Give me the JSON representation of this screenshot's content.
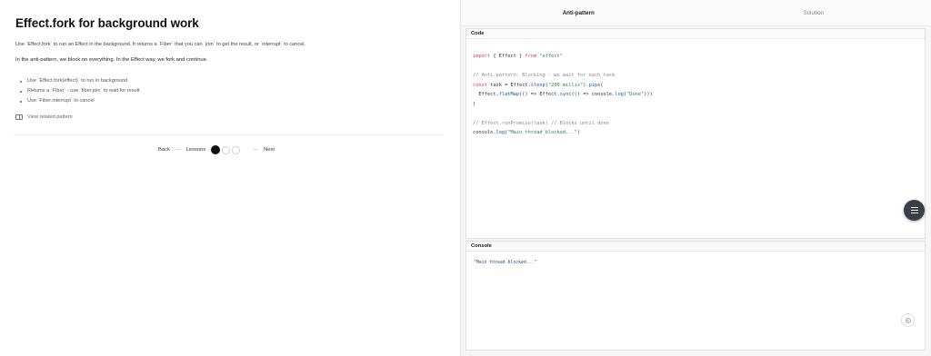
{
  "lesson": {
    "title": "Effect.fork for background work",
    "description": "Use `Effect.fork` to run an Effect in the background. It returns a `Fiber` that you can `join` to get the result, or `interrupt` to cancel.",
    "summary": "In the anti-pattern, we block on everything. In the Effect way, we fork and continue.",
    "bullets": [
      "Use `Effect.fork(effect)` to run in background",
      "Returns a `Fiber` - use `fiber.join` to wait for result",
      "Use `Fiber.interrupt` to cancel"
    ],
    "related_link": "View related pattern"
  },
  "nav": {
    "back": "Back",
    "sep1": "—",
    "lessons": "Lessons",
    "sep2": "—",
    "next": "Next",
    "current_index": 1,
    "total": 3
  },
  "tabs": [
    {
      "label": "Anti-pattern",
      "active": true
    },
    {
      "label": "Solution",
      "active": false
    }
  ],
  "code_panel": {
    "header": "Code",
    "lines": [
      [
        {
          "t": "import",
          "c": "kw"
        },
        {
          "t": " { Effect } ",
          "c": ""
        },
        {
          "t": "from",
          "c": "kw"
        },
        {
          "t": " ",
          "c": ""
        },
        {
          "t": "\"effect\"",
          "c": "str"
        }
      ],
      [],
      [
        {
          "t": "// Anti-pattern: Blocking - we wait for each task",
          "c": "cm"
        }
      ],
      [
        {
          "t": "const",
          "c": "kw"
        },
        {
          "t": " task = Effect.",
          "c": ""
        },
        {
          "t": "sleep",
          "c": "fn"
        },
        {
          "t": "(",
          "c": ""
        },
        {
          "t": "\"200 millis\"",
          "c": "str"
        },
        {
          "t": ").",
          "c": ""
        },
        {
          "t": "pipe",
          "c": "fn"
        },
        {
          "t": "(",
          "c": ""
        }
      ],
      [
        {
          "t": "  Effect.",
          "c": ""
        },
        {
          "t": "flatMap",
          "c": "fn"
        },
        {
          "t": "(() => Effect.",
          "c": ""
        },
        {
          "t": "sync",
          "c": "fn"
        },
        {
          "t": "(() => console.",
          "c": ""
        },
        {
          "t": "log",
          "c": "fn"
        },
        {
          "t": "(",
          "c": ""
        },
        {
          "t": "\"Done\"",
          "c": "str"
        },
        {
          "t": ")))",
          "c": ""
        }
      ],
      [
        {
          "t": ")",
          "c": ""
        }
      ],
      [],
      [
        {
          "t": "// Effect.runPromise(task) // Blocks until done",
          "c": "cm"
        }
      ],
      [
        {
          "t": "console.",
          "c": ""
        },
        {
          "t": "log",
          "c": "fn"
        },
        {
          "t": "(",
          "c": ""
        },
        {
          "t": "\"Main thread blocked...\"",
          "c": "str"
        },
        {
          "t": ")",
          "c": ""
        }
      ]
    ]
  },
  "console_panel": {
    "header": "Console",
    "output": "\"Main thread blocked...\""
  },
  "icons": {
    "related": "book-icon",
    "fab": "menu-icon",
    "clear": "ban-icon"
  },
  "colors": {
    "keyword": "#d73a49",
    "string": "#22863a",
    "function": "#0b5ea8",
    "comment": "#888888",
    "active_dot": "#111111",
    "fab_bg": "#3a3f47"
  }
}
